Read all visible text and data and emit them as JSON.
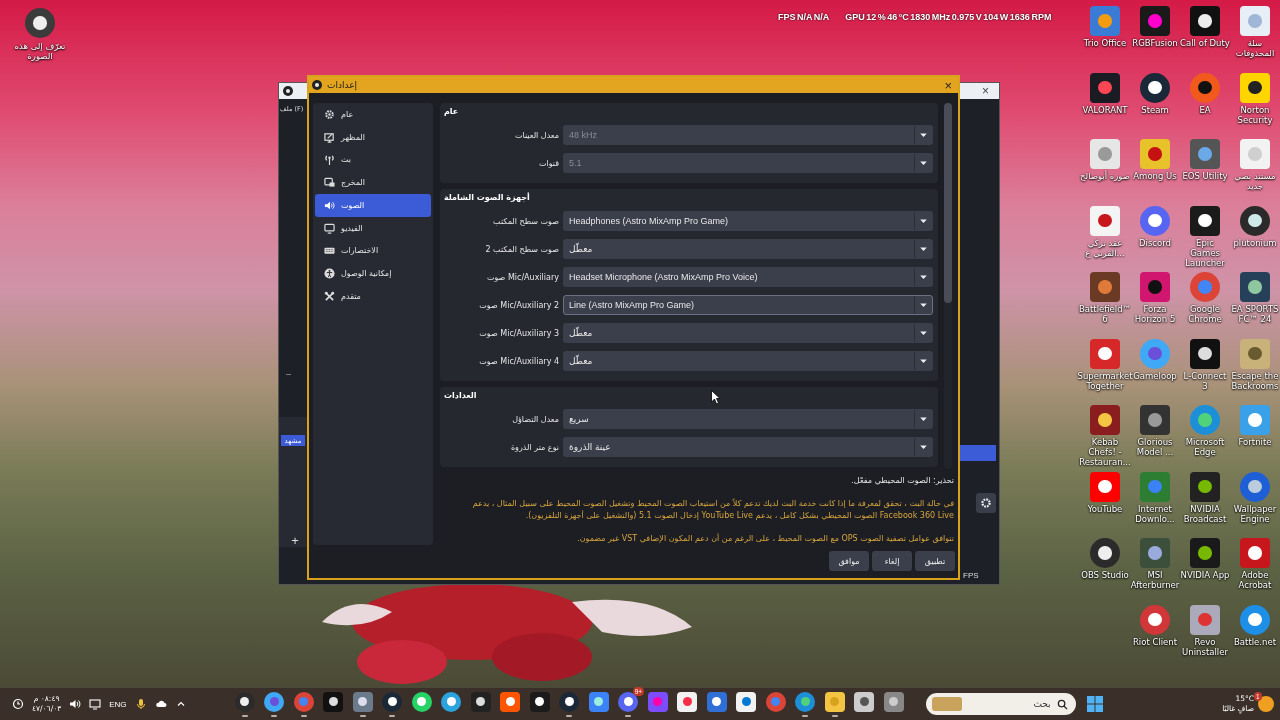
{
  "desktop": {
    "top_left_shortcut": {
      "label": "تعرّف إلى هذه الصورة",
      "kind": "spotlight"
    },
    "shortcuts": [
      {
        "label": "سلة المحذوفات",
        "kind": "bin"
      },
      {
        "label": "Norton Security",
        "kind": "norton"
      },
      {
        "label": "مستند نصي جديد",
        "kind": "doc"
      },
      {
        "label": "plutonium",
        "kind": "atom"
      },
      {
        "label": "EA SPORTS FC™ 24",
        "kind": "fc"
      },
      {
        "label": "Escape the Backrooms",
        "kind": "backrooms"
      },
      {
        "label": "Fortnite",
        "kind": "fortnite"
      },
      {
        "label": "Wallpaper Engine",
        "kind": "wallpaper"
      },
      {
        "label": "Adobe Acrobat",
        "kind": "acrobat"
      },
      {
        "label": "Battle.net",
        "kind": "battlenet"
      },
      {
        "label": "Call of Duty",
        "kind": "cod"
      },
      {
        "label": "EA",
        "kind": "ea"
      },
      {
        "label": "EOS Utility",
        "kind": "camera"
      },
      {
        "label": "Epic Games Launcher",
        "kind": "epic"
      },
      {
        "label": "Google Chrome",
        "kind": "chrome"
      },
      {
        "label": "L-Connect 3",
        "kind": "lconnect"
      },
      {
        "label": "Microsoft Edge",
        "kind": "edge"
      },
      {
        "label": "NVIDIA Broadcast",
        "kind": "nvbroadcast"
      },
      {
        "label": "NVIDIA App",
        "kind": "nvidia"
      },
      {
        "label": "Revo Uninstaller",
        "kind": "revo"
      },
      {
        "label": "RGBFusion",
        "kind": "rgb"
      },
      {
        "label": "Steam",
        "kind": "steam"
      },
      {
        "label": "Among Us",
        "kind": "among"
      },
      {
        "label": "Discord",
        "kind": "discord"
      },
      {
        "label": "Forza Horizon 5",
        "kind": "forza"
      },
      {
        "label": "Gameloop",
        "kind": "gameloop"
      },
      {
        "label": "Glorious Model ...",
        "kind": "mouse"
      },
      {
        "label": "Internet Downlo...",
        "kind": "idm"
      },
      {
        "label": "MSI Afterburner",
        "kind": "msi"
      },
      {
        "label": "Riot Client",
        "kind": "riot"
      },
      {
        "label": "Trio Office",
        "kind": "office"
      },
      {
        "label": "VALORANT",
        "kind": "valorant"
      },
      {
        "label": "صورة أبوصالح",
        "kind": "photo"
      },
      {
        "label": "عقد تركي القرني ع...",
        "kind": "pdf"
      },
      {
        "label": "Battlefield™ 6",
        "kind": "bf"
      },
      {
        "label": "Supermarket Together",
        "kind": "st"
      },
      {
        "label": "Kebab Chefs! - Restauran...",
        "kind": "kebab"
      },
      {
        "label": "YouTube",
        "kind": "youtube"
      },
      {
        "label": "OBS Studio",
        "kind": "obs"
      }
    ]
  },
  "overlay": {
    "fps": "FPS N/A N/A",
    "gpu": "GPU 12 % 46 °C 1830 MHz 0.975 V 104 W 1636 RPM"
  },
  "obs_window": {
    "close": "×",
    "menu": "ملف (F)",
    "minimize": "–",
    "scene": "مشهد",
    "add": "+",
    "fps": "FPS"
  },
  "settings": {
    "title": "إعدادات",
    "close": "×",
    "sidebar": [
      {
        "label": "عام",
        "selected": false
      },
      {
        "label": "المظهر",
        "selected": false
      },
      {
        "label": "بث",
        "selected": false
      },
      {
        "label": "المخرج",
        "selected": false
      },
      {
        "label": "الصوت",
        "selected": true
      },
      {
        "label": "الفيديو",
        "selected": false
      },
      {
        "label": "الاختصارات",
        "selected": false
      },
      {
        "label": "إمكانية الوصول",
        "selected": false
      },
      {
        "label": "متقدم",
        "selected": false
      }
    ],
    "groups": [
      {
        "title": "عام",
        "rows": [
          {
            "label": "معدل العينات",
            "value": "48 kHz",
            "disabled": true,
            "focused": false
          },
          {
            "label": "قنوات",
            "value": "5.1",
            "disabled": true,
            "focused": false
          }
        ]
      },
      {
        "title": "أجهزة الصوت الشاملة",
        "rows": [
          {
            "label": "صوت سطح المكتب",
            "value": "Headphones (Astro MixAmp Pro Game)",
            "disabled": false,
            "focused": false
          },
          {
            "label": "صوت سطح المكتب 2",
            "value": "معطّل",
            "disabled": false,
            "focused": false
          },
          {
            "label": "صوت Mic/Auxiliary",
            "value": "Headset Microphone (Astro MixAmp Pro Voice)",
            "disabled": false,
            "focused": false
          },
          {
            "label": "صوت Mic/Auxiliary 2",
            "value": "Line (Astro MixAmp Pro Game)",
            "disabled": false,
            "focused": true
          },
          {
            "label": "صوت Mic/Auxiliary 3",
            "value": "معطّل",
            "disabled": false,
            "focused": false
          },
          {
            "label": "صوت Mic/Auxiliary 4",
            "value": "معطّل",
            "disabled": false,
            "focused": false
          }
        ]
      },
      {
        "title": "العدادات",
        "rows": [
          {
            "label": "معدل التضاؤل",
            "value": "سريع",
            "disabled": false,
            "focused": false
          },
          {
            "label": "نوع متر الذروة",
            "value": "عينة الذروة",
            "disabled": false,
            "focused": false
          }
        ]
      }
    ],
    "warning": {
      "heading": "تحذير: الصوت المحيطي مفعّل.",
      "paragraphs": [
        "في حالة البث ، تحقق لمعرفة ما إذا كانت خدمة البث لديك تدعم كلاً من استيعاب الصوت المحيط وتشغيل الصوت المحيط على سبيل المثال ، يدعم Facebook 360 Live الصوت المحيطي بشكل كامل ، يدعم YouTube Live إدخال الصوت 5.1 (والتشغيل على أجهزة التلفزيون).",
        "تتوافق عوامل تصفية الصوت OPS مع الصوت المحيط ، على الرغم من أن دعم المكون الإضافي VST غير مضمون."
      ]
    },
    "buttons": [
      "تطبيق",
      "إلغاء",
      "موافق"
    ]
  },
  "taskbar": {
    "time": "٠٨:٤٩ م",
    "date": "٤٧/٠٦/٠٣",
    "language": "ENG",
    "apps": [
      {
        "kind": "obs",
        "running": true
      },
      {
        "kind": "gameloop",
        "running": true
      },
      {
        "kind": "chrome",
        "running": true
      },
      {
        "kind": "lconnect",
        "running": false
      },
      {
        "kind": "settings",
        "running": true
      },
      {
        "kind": "steam",
        "running": true
      },
      {
        "kind": "whatsapp",
        "running": false
      },
      {
        "kind": "telegram",
        "running": false
      },
      {
        "kind": "happ",
        "running": false
      },
      {
        "kind": "soundcloud",
        "running": false
      },
      {
        "kind": "epic",
        "running": false
      },
      {
        "kind": "steam",
        "running": true
      },
      {
        "kind": "bluestacks",
        "running": false
      },
      {
        "kind": "discord",
        "running": true,
        "badge": "9+"
      },
      {
        "kind": "m365",
        "running": false
      },
      {
        "kind": "music",
        "running": false
      },
      {
        "kind": "mail",
        "running": false
      },
      {
        "kind": "store",
        "running": false
      },
      {
        "kind": "chrome",
        "running": false
      },
      {
        "kind": "edge",
        "running": true
      },
      {
        "kind": "folder",
        "running": true
      },
      {
        "kind": "app",
        "running": false
      },
      {
        "kind": "gray",
        "running": false
      }
    ],
    "search": {
      "placeholder": "بحث"
    },
    "weather": {
      "temperature": "15°C",
      "condition": "صافٍ غالبًا",
      "badge": "1"
    }
  }
}
